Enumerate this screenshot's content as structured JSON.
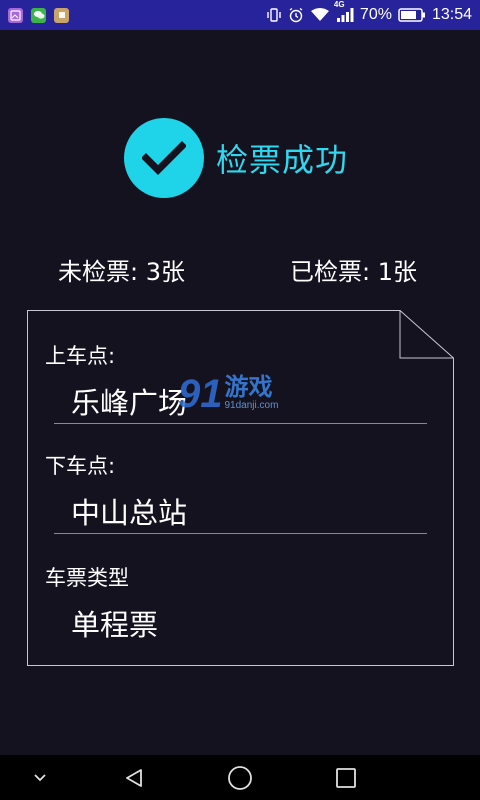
{
  "status_bar": {
    "battery_percent": "70%",
    "time": "13:54",
    "network": "4G",
    "icons": [
      "gallery-app-icon",
      "wechat-icon",
      "notification-app-icon",
      "vibrate-icon",
      "alarm-icon",
      "wifi-icon",
      "signal-icon",
      "battery-icon"
    ]
  },
  "success": {
    "title": "检票成功",
    "icon": "check-icon",
    "accent": "#1fd3e8"
  },
  "counts": {
    "unchecked": "未检票: 3张",
    "checked": "已检票: 1张"
  },
  "ticket": {
    "boarding_label": "上车点:",
    "boarding_value": "乐峰广场",
    "alighting_label": "下车点:",
    "alighting_value": "中山总站",
    "type_label": "车票类型",
    "type_value": "单程票"
  },
  "watermark": {
    "logo": "91",
    "name": "游戏",
    "url": "91danji.com"
  },
  "nav_bar": {
    "icons": [
      "collapse-icon",
      "back-icon",
      "home-icon",
      "recents-icon"
    ]
  }
}
